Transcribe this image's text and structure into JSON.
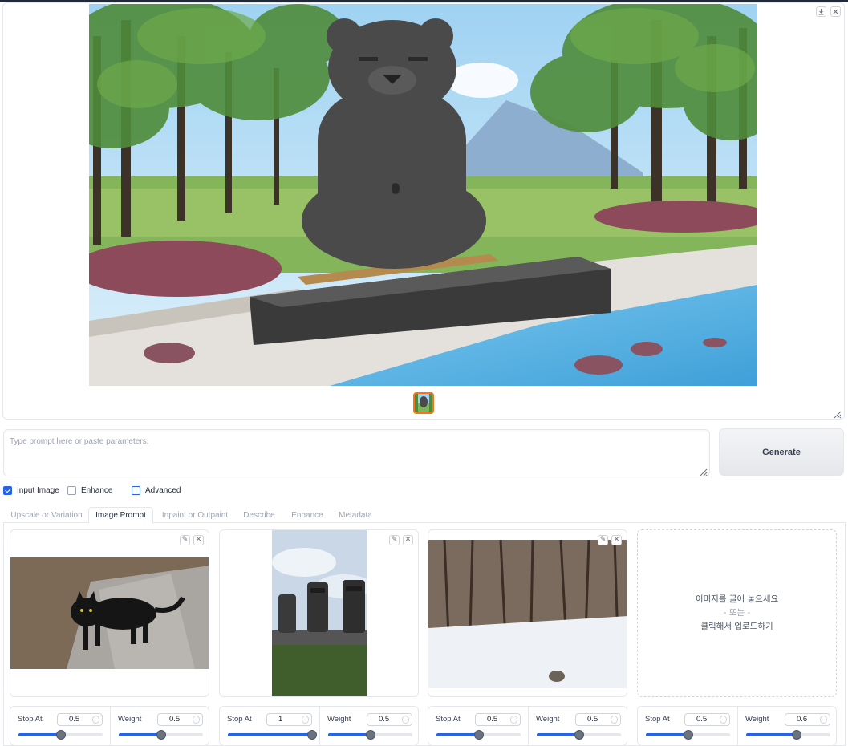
{
  "gallery": {
    "download_icon": "download-icon",
    "close_icon": "close-icon"
  },
  "prompt": {
    "placeholder": "Type prompt here or paste parameters.",
    "value": ""
  },
  "generate_label": "Generate",
  "options": [
    {
      "label": "Input Image",
      "checked": true
    },
    {
      "label": "Enhance",
      "checked": false
    },
    {
      "label": "Advanced",
      "checked": false
    }
  ],
  "tabs": [
    "Upscale or Variation",
    "Image Prompt",
    "Inpaint or Outpaint",
    "Describe",
    "Enhance",
    "Metadata"
  ],
  "active_tab": "Image Prompt",
  "dropzone": {
    "line1": "이미지를 끌어 놓으세요",
    "line2": "- 또는 -",
    "line3": "클릭해서 업로드하기"
  },
  "controls": [
    {
      "stop_label": "Stop At",
      "stop": 0.5,
      "stop_text": "0.5",
      "weight_label": "Weight",
      "weight": 0.5,
      "weight_text": "0.5"
    },
    {
      "stop_label": "Stop At",
      "stop": 1,
      "stop_text": "1",
      "weight_label": "Weight",
      "weight": 0.5,
      "weight_text": "0.5"
    },
    {
      "stop_label": "Stop At",
      "stop": 0.5,
      "stop_text": "0.5",
      "weight_label": "Weight",
      "weight": 0.5,
      "weight_text": "0.5"
    },
    {
      "stop_label": "Stop At",
      "stop": 0.5,
      "stop_text": "0.5",
      "weight_label": "Weight",
      "weight": 0.6,
      "weight_text": "0.6"
    }
  ],
  "colors": {
    "accent": "#2563eb",
    "thumb_border": "#f97316"
  }
}
